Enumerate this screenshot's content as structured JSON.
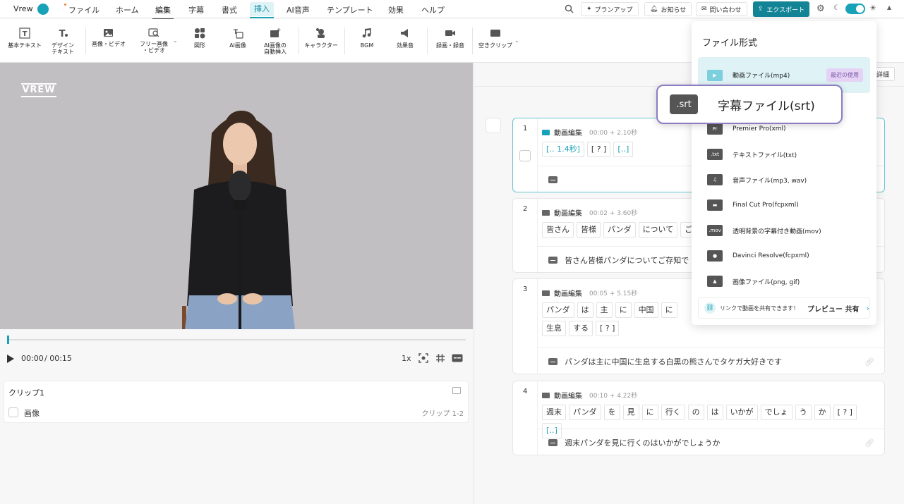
{
  "menubar": {
    "brand": "Vrew",
    "items": [
      "ファイル",
      "ホーム",
      "編集",
      "字幕",
      "書式",
      "挿入",
      "AI音声",
      "テンプレート",
      "効果",
      "ヘルプ"
    ],
    "plan_up": "プランアップ",
    "notice": "お知らせ",
    "contact": "問い合わせ",
    "export": "エクスポート"
  },
  "toolbar": {
    "tools": [
      "基本テキスト",
      "デザイン\nテキスト",
      "画像・ビデオ",
      "フリー画像\n・ビデオ",
      "図形",
      "AI画像",
      "AI画像の\n自動挿入",
      "キャラクター",
      "BGM",
      "効果音",
      "録画・録音",
      "空きクリップ"
    ]
  },
  "preview": {
    "logo": "VREW",
    "current_time": "00:00",
    "total_time": "/ 00:15",
    "speed": "1x"
  },
  "clip_panel": {
    "title": "クリップ1",
    "item_label": "画像",
    "range": "クリップ 1-2"
  },
  "editor": {
    "detail_button": "詳細",
    "clips": [
      {
        "num": "1",
        "title": "動画編集",
        "meta": "00:00 + 2.10秒",
        "words": [
          "[‥ 1.4秒]",
          "[ ? ]",
          "[‥]"
        ],
        "subtitle": ""
      },
      {
        "num": "2",
        "title": "動画編集",
        "meta": "00:02 + 3.60秒",
        "words": [
          "皆さん",
          "皆様",
          "パンダ",
          "について",
          "ご存知"
        ],
        "subtitle": "皆さん皆様パンダについてご存知で"
      },
      {
        "num": "3",
        "title": "動画編集",
        "meta": "00:05 + 5.15秒",
        "words": [
          "パンダ",
          "は",
          "主",
          "に",
          "中国",
          "に",
          "生息",
          "する",
          "[ ? ]"
        ],
        "subtitle": "パンダは主に中国に生息する白黒の熊さんでタケガ大好きです"
      },
      {
        "num": "4",
        "title": "動画編集",
        "meta": "00:10 + 4.22秒",
        "words": [
          "週末",
          "パンダ",
          "を",
          "見",
          "に",
          "行く",
          "の",
          "は",
          "いかが",
          "でしょ",
          "う",
          "か",
          "[ ? ]",
          "[‥]"
        ],
        "subtitle": "週末パンダを見に行くのはいかがでしょうか"
      }
    ]
  },
  "export_menu": {
    "title": "ファイル形式",
    "recent_badge": "最近の使用",
    "items": [
      {
        "icon": "▶",
        "label": "動画ファイル(mp4)"
      },
      {
        "icon": "Pr",
        "label": "Premier Pro(xml)"
      },
      {
        "icon": ".txt",
        "label": "テキストファイル(txt)"
      },
      {
        "icon": "♫",
        "label": "音声ファイル(mp3, wav)"
      },
      {
        "icon": "▬",
        "label": "Final Cut Pro(fcpxml)"
      },
      {
        "icon": ".mov",
        "label": "透明背景の字幕付き動画(mov)"
      },
      {
        "icon": "●",
        "label": "Davinci Resolve(fcpxml)"
      },
      {
        "icon": "▲",
        "label": "画像ファイル(png, gif)"
      }
    ],
    "share_text": "リンクで動画を共有できます！",
    "share_action": "プレビュー 共有"
  },
  "callout": {
    "icon": ".srt",
    "label": "字幕ファイル(srt)"
  }
}
